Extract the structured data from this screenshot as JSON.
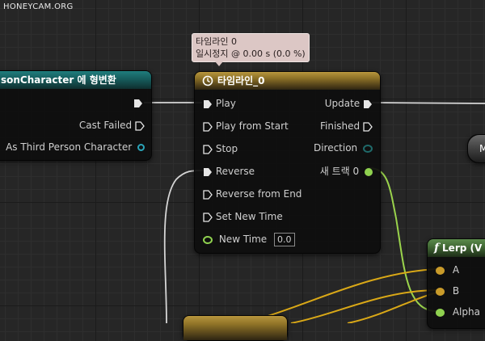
{
  "watermark": "HONEYCAM.ORG",
  "tooltip": {
    "line1": "타임라인 0",
    "line2": "일시정지 @ 0.00 s (0.0 %)"
  },
  "cast_node": {
    "title": "sonCharacter 에 형변환",
    "pins": {
      "cast_failed": "Cast Failed",
      "as_character": "As Third Person Character"
    }
  },
  "timeline_node": {
    "title": "타임라인_0",
    "inputs": {
      "play": "Play",
      "play_from_start": "Play from Start",
      "stop": "Stop",
      "reverse": "Reverse",
      "reverse_from_end": "Reverse from End",
      "set_new_time": "Set New Time",
      "new_time": "New Time",
      "new_time_value": "0.0"
    },
    "outputs": {
      "update": "Update",
      "finished": "Finished",
      "direction": "Direction",
      "track": "새 트랙 0"
    }
  },
  "lerp_node": {
    "title": "Lerp (V",
    "icon": "f",
    "pins": {
      "a": "A",
      "b": "B",
      "alpha": "Alpha"
    }
  },
  "partial_node": {
    "title": "M"
  },
  "colors": {
    "exec": "#e6e6e6",
    "vector_pin": "#c99b2a",
    "float_pin": "#8fd14f",
    "object_pin": "#2aa4b8",
    "float_wire": "#9ad34c",
    "vector_wire": "#d9a817",
    "exec_wire": "#d6d6d6"
  }
}
